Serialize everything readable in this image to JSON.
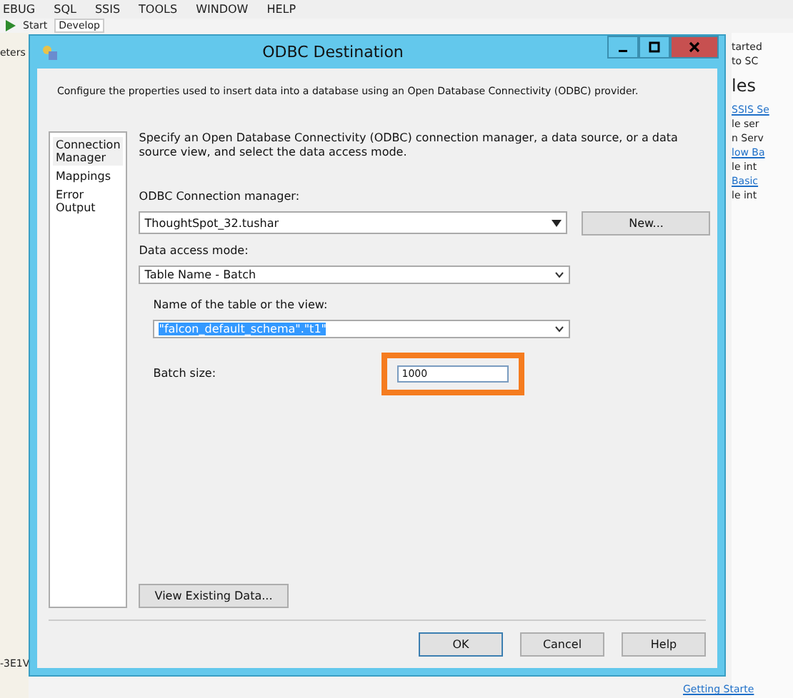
{
  "ide": {
    "menu": [
      "EBUG",
      "SQL",
      "SSIS",
      "TOOLS",
      "WINDOW",
      "HELP"
    ],
    "toolbar": {
      "start": "Start",
      "configuration": "Develop"
    },
    "left_panel": {
      "tab": "eters",
      "footer": "-3E1V"
    },
    "right_panel": {
      "lines": [
        {
          "kind": "text",
          "text": "tarted"
        },
        {
          "kind": "text",
          "text": "to SC"
        },
        {
          "kind": "heading",
          "text": "les"
        },
        {
          "kind": "link",
          "text": "SSIS Se"
        },
        {
          "kind": "text",
          "text": "le ser"
        },
        {
          "kind": "text",
          "text": "n Serv"
        },
        {
          "kind": "link",
          "text": "low Ba"
        },
        {
          "kind": "text",
          "text": "le int"
        },
        {
          "kind": "link",
          "text": "Basic"
        },
        {
          "kind": "text",
          "text": "le int"
        }
      ],
      "footer_link": "Getting Starte"
    }
  },
  "dialog": {
    "title": "ODBC Destination",
    "description": "Configure the properties used to insert data into a database using an Open Database Connectivity (ODBC) provider.",
    "pages": [
      {
        "label": "Connection Manager",
        "selected": true
      },
      {
        "label": "Mappings",
        "selected": false
      },
      {
        "label": "Error Output",
        "selected": false
      }
    ],
    "instructions": "Specify an Open Database Connectivity (ODBC) connection manager, a data source, or a data source view, and select the data access mode.",
    "connection_manager": {
      "label": "ODBC Connection manager:",
      "value": "ThoughtSpot_32.tushar",
      "new_button": "New..."
    },
    "access_mode": {
      "label": "Data access mode:",
      "value": "Table Name - Batch"
    },
    "table": {
      "label": "Name of the table or the view:",
      "value": "\"falcon_default_schema\".\"t1\""
    },
    "batch": {
      "label": "Batch size:",
      "value": "1000",
      "highlighted": true
    },
    "view_button": "View Existing Data...",
    "buttons": [
      "OK",
      "Cancel",
      "Help"
    ]
  }
}
